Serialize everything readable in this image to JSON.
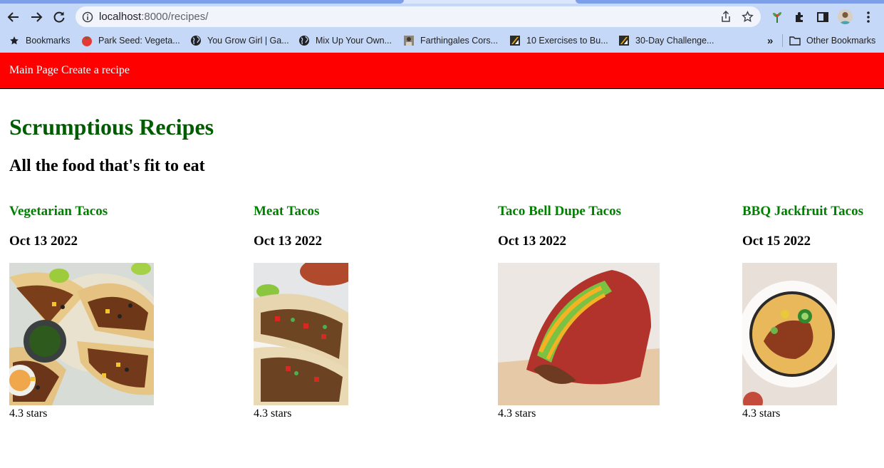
{
  "browser": {
    "url_host": "localhost",
    "url_path": ":8000/recipes/",
    "bookmarks": [
      {
        "label": "Bookmarks",
        "icon": "star-icon"
      },
      {
        "label": "Park Seed: Vegeta...",
        "icon": "tomato-icon"
      },
      {
        "label": "You Grow Girl | Ga...",
        "icon": "globe-icon"
      },
      {
        "label": "Mix Up Your Own...",
        "icon": "globe-icon"
      },
      {
        "label": "Farthingales Cors...",
        "icon": "site-favicon"
      },
      {
        "label": "10 Exercises to Bu...",
        "icon": "site-favicon"
      },
      {
        "label": "30-Day Challenge...",
        "icon": "site-favicon"
      }
    ],
    "overflow_label": "»",
    "other_bookmarks": "Other Bookmarks"
  },
  "nav": {
    "main_page": "Main Page",
    "create_recipe": "Create a recipe",
    "background": "#ff0000"
  },
  "page": {
    "title": "Scrumptious Recipes",
    "subtitle": "All the food that's fit to eat",
    "title_color": "#005c00",
    "recipe_title_color": "#008000"
  },
  "recipes": [
    {
      "name": "Vegetarian Tacos",
      "date": "Oct 13 2022",
      "rating": "4.3 stars"
    },
    {
      "name": "Meat Tacos",
      "date": "Oct 13 2022",
      "rating": "4.3 stars"
    },
    {
      "name": "Taco Bell Dupe Tacos",
      "date": "Oct 13 2022",
      "rating": "4.3 stars"
    },
    {
      "name": "BBQ Jackfruit Tacos",
      "date": "Oct 15 2022",
      "rating": "4.3 stars"
    }
  ]
}
